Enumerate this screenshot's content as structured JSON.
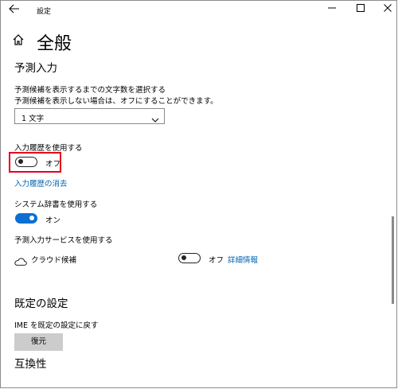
{
  "window": {
    "title": "設定",
    "back_icon": "back-arrow-icon",
    "minimize_icon": "minimize-icon",
    "maximize_icon": "maximize-icon",
    "close_icon": "close-icon"
  },
  "page": {
    "title": "全般",
    "home_icon": "home-icon"
  },
  "predictive_input": {
    "heading": "予測入力",
    "description_line1": "予測候補を表示するまでの文字数を選択する",
    "description_line2": "予測候補を表示しない場合は、オフにすることができます。",
    "char_count_select": "1 文字",
    "input_history": {
      "label": "入力履歴を使用する",
      "state_label": "オフ",
      "enabled": false
    },
    "clear_history_link": "入力履歴の消去",
    "system_dictionary": {
      "label": "システム辞書を使用する",
      "state_label": "オン",
      "enabled": true
    },
    "predictive_service": {
      "label": "予測入力サービスを使用する",
      "cloud_candidates_label": "クラウド候補",
      "cloud_icon": "cloud-icon",
      "state_label": "オフ",
      "enabled": false,
      "details_link": "詳細情報"
    }
  },
  "default_settings": {
    "heading": "既定の設定",
    "reset_label": "IME を既定の設定に戻す",
    "restore_button": "復元"
  },
  "compatibility": {
    "heading": "互換性"
  },
  "colors": {
    "accent": "#0063b1",
    "toggle_on": "#0a6fd1",
    "highlight": "#e8001c"
  }
}
